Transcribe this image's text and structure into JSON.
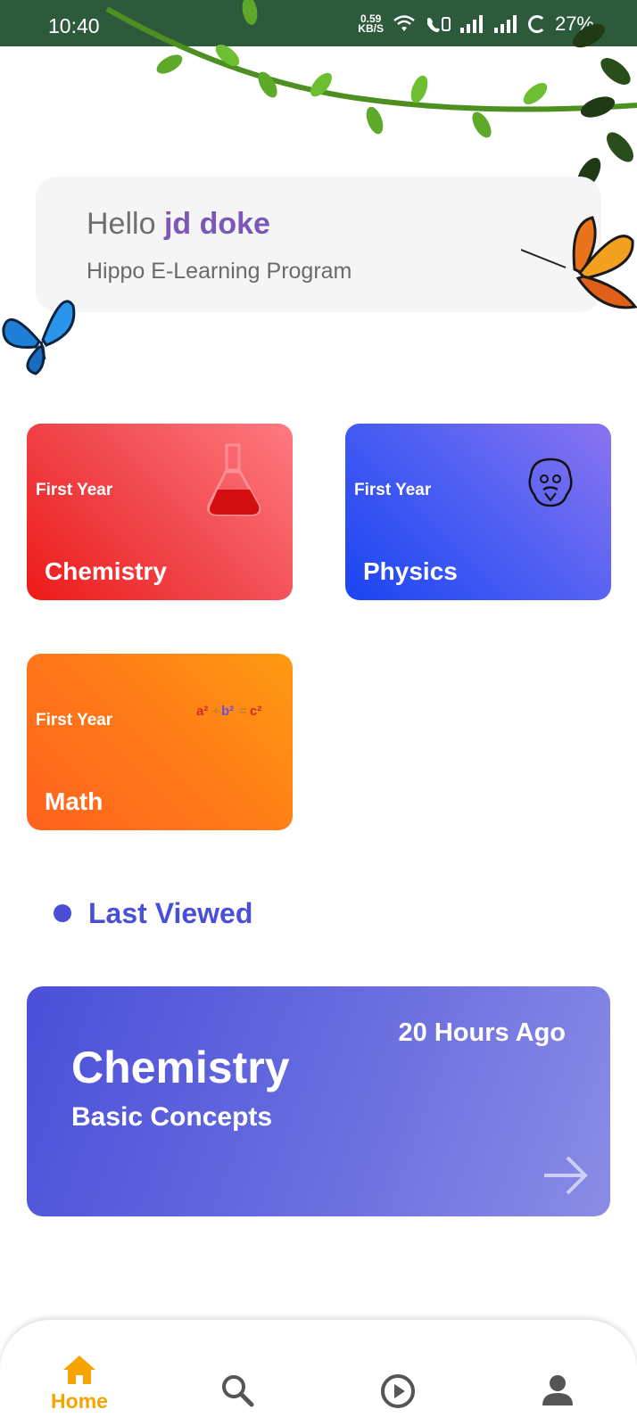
{
  "status_bar": {
    "time": "10:40",
    "net_speed_value": "0.59",
    "net_speed_unit": "KB/S",
    "battery": "27%"
  },
  "greeting": {
    "hello": "Hello",
    "name": "jd doke",
    "subtitle": "Hippo E-Learning Program"
  },
  "subjects": [
    {
      "year": "First Year",
      "name": "Chemistry",
      "icon": "flask-icon"
    },
    {
      "year": "First Year",
      "name": "Physics",
      "icon": "einstein-icon"
    },
    {
      "year": "First Year",
      "name": "Math",
      "icon": "pythagoras-formula-icon"
    }
  ],
  "last_viewed": {
    "heading": "Last Viewed",
    "subject": "Chemistry",
    "topic": "Basic Concepts",
    "time_ago": "20 Hours Ago"
  },
  "nav": {
    "home_label": "Home",
    "active": "home"
  },
  "colors": {
    "accent": "#4a4fd8",
    "nav_active": "#f5a400",
    "greeting_name": "#7a57b8",
    "status_bar": "#2e5a3c"
  }
}
